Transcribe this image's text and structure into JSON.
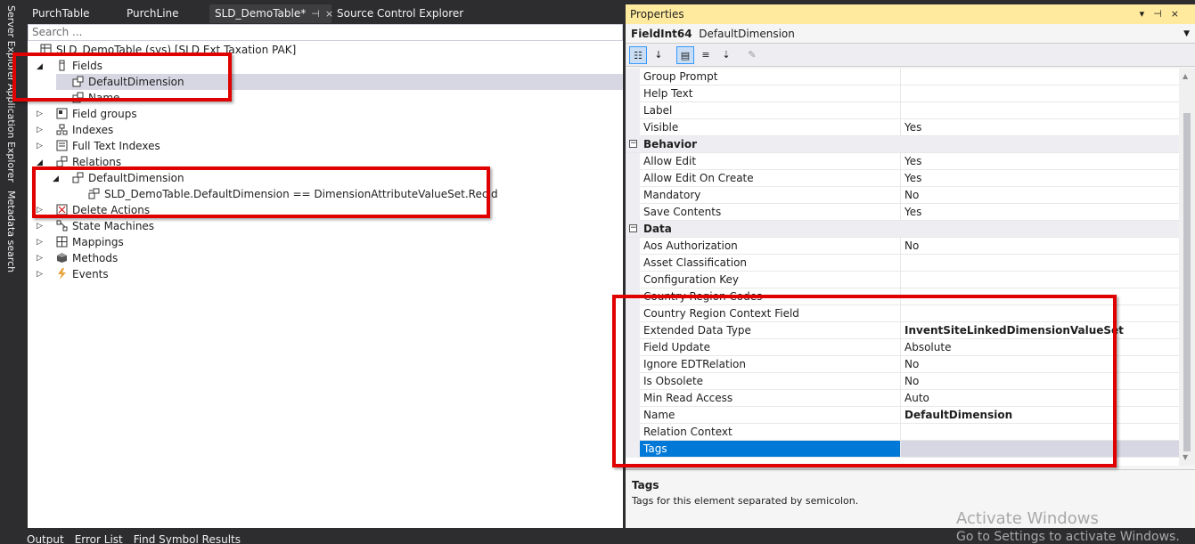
{
  "sidebar": {
    "items": [
      {
        "label": "Server Explorer"
      },
      {
        "label": "Application Explorer"
      },
      {
        "label": "Metadata search"
      }
    ]
  },
  "tabs": [
    {
      "label": "PurchTable"
    },
    {
      "label": "PurchLine"
    },
    {
      "label": "SLD_DemoTable*"
    },
    {
      "label": "Source Control Explorer"
    }
  ],
  "tab_controls": {
    "pin": "⊣",
    "close": "×"
  },
  "editor": {
    "search_placeholder": "Search ...",
    "root": "SLD_DemoTable (sys) [SLD Ext Taxation PAK]",
    "nodes": {
      "fields": "Fields",
      "field_default_dimension": "DefaultDimension",
      "field_name": "Name",
      "field_groups": "Field groups",
      "indexes": "Indexes",
      "full_text_indexes": "Full Text Indexes",
      "relations": "Relations",
      "relation_default_dimension": "DefaultDimension",
      "relation_constraint": "SLD_DemoTable.DefaultDimension == DimensionAttributeValueSet.RecId",
      "delete_actions": "Delete Actions",
      "state_machines": "State Machines",
      "mappings": "Mappings",
      "methods": "Methods",
      "events": "Events"
    }
  },
  "properties": {
    "title": "Properties",
    "object_type": "FieldInt64",
    "object_name": "DefaultDimension",
    "rows": [
      {
        "name": "Group Prompt",
        "value": ""
      },
      {
        "name": "Help Text",
        "value": ""
      },
      {
        "name": "Label",
        "value": ""
      },
      {
        "name": "Visible",
        "value": "Yes"
      },
      {
        "category": "Behavior"
      },
      {
        "name": "Allow Edit",
        "value": "Yes"
      },
      {
        "name": "Allow Edit On Create",
        "value": "Yes"
      },
      {
        "name": "Mandatory",
        "value": "No"
      },
      {
        "name": "Save Contents",
        "value": "Yes"
      },
      {
        "category": "Data"
      },
      {
        "name": "Aos Authorization",
        "value": "No"
      },
      {
        "name": "Asset Classification",
        "value": ""
      },
      {
        "name": "Configuration Key",
        "value": ""
      },
      {
        "name": "Country Region Codes",
        "value": ""
      },
      {
        "name": "Country Region Context Field",
        "value": ""
      },
      {
        "name": "Extended Data Type",
        "value": "InventSiteLinkedDimensionValueSet"
      },
      {
        "name": "Field Update",
        "value": "Absolute"
      },
      {
        "name": "Ignore EDTRelation",
        "value": "No"
      },
      {
        "name": "Is Obsolete",
        "value": "No"
      },
      {
        "name": "Min Read Access",
        "value": "Auto"
      },
      {
        "name": "Name",
        "value": "DefaultDimension"
      },
      {
        "name": "Relation Context",
        "value": ""
      },
      {
        "name": "Tags",
        "value": ""
      }
    ],
    "description_title": "Tags",
    "description_text": "Tags for this element separated by semicolon."
  },
  "bottom_tabs": [
    "Output",
    "Error List",
    "Find Symbol Results"
  ],
  "watermark": {
    "line1": "Activate Windows",
    "line2": "Go to Settings to activate Windows."
  },
  "colors": {
    "accent": "#0078d7",
    "highlight_box": "#e00000",
    "title_bar": "#ffea9e"
  }
}
